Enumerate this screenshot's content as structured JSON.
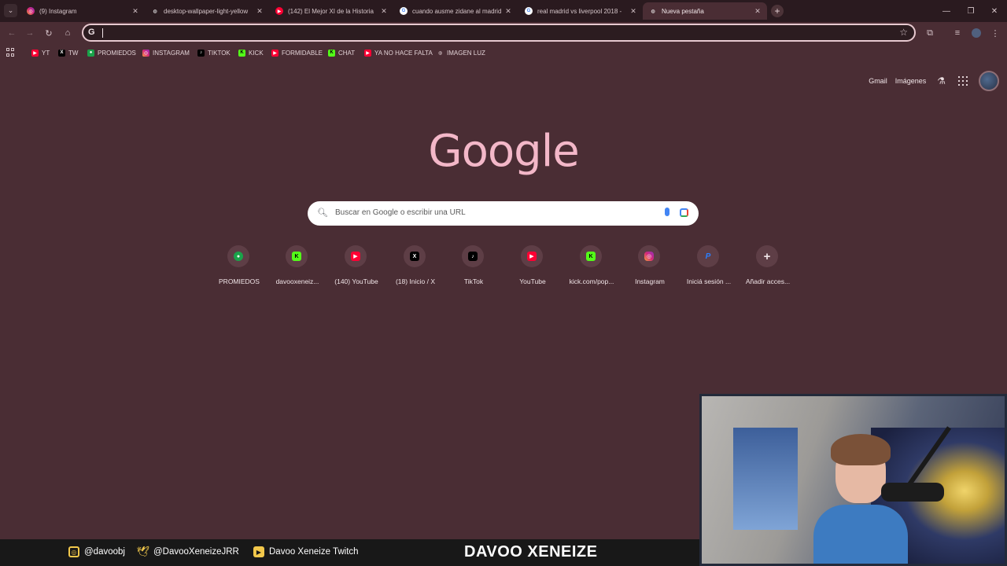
{
  "browser": {
    "tabs": [
      {
        "title": "(9) Instagram",
        "icon": "instagram-icon",
        "active": false
      },
      {
        "title": "desktop-wallpaper-light-yellow",
        "icon": "globe-icon",
        "active": false
      },
      {
        "title": "(142) El Mejor XI de la Historia",
        "icon": "youtube-icon",
        "active": false
      },
      {
        "title": "cuando ausme zidane al madrid",
        "icon": "google-icon",
        "active": false
      },
      {
        "title": "real madrid vs liverpool 2018 -",
        "icon": "google-icon",
        "active": false
      },
      {
        "title": "Nueva pestaña",
        "icon": "chrome-icon",
        "active": true
      }
    ],
    "close_glyph": "✕",
    "new_tab_glyph": "+",
    "omnibox": {
      "value": "",
      "placeholder": ""
    },
    "bookmarks": [
      {
        "label": "YT",
        "icon": "youtube-icon"
      },
      {
        "label": "TW",
        "icon": "x-icon"
      },
      {
        "label": "PROMIEDOS",
        "icon": "promiedos-icon"
      },
      {
        "label": "INSTAGRAM",
        "icon": "instagram-icon"
      },
      {
        "label": "TIKTOK",
        "icon": "tiktok-icon"
      },
      {
        "label": "KICK",
        "icon": "kick-icon"
      },
      {
        "label": "FORMIDABLE",
        "icon": "youtube-icon"
      },
      {
        "label": "CHAT",
        "icon": "kick-icon"
      },
      {
        "label": "YA NO HACE FALTA",
        "icon": "youtube-icon"
      },
      {
        "label": "IMAGEN LUZ",
        "icon": "globe-icon"
      }
    ]
  },
  "google": {
    "logo": "Google",
    "links": {
      "gmail": "Gmail",
      "images": "Imágenes"
    },
    "search_placeholder": "Buscar en Google o escribir una URL",
    "shortcuts": [
      {
        "label": "PROMIEDOS",
        "icon": "promiedos-icon"
      },
      {
        "label": "davooxeneiz...",
        "icon": "kick-icon"
      },
      {
        "label": "(140) YouTube",
        "icon": "youtube-icon"
      },
      {
        "label": "(18) Inicio / X",
        "icon": "x-icon"
      },
      {
        "label": "TikTok",
        "icon": "tiktok-icon"
      },
      {
        "label": "YouTube",
        "icon": "youtube-icon"
      },
      {
        "label": "kick.com/pop...",
        "icon": "kick-icon"
      },
      {
        "label": "Instagram",
        "icon": "instagram-icon"
      },
      {
        "label": "Iniciá sesión ...",
        "icon": "paypal-icon"
      },
      {
        "label": "Añadir acces...",
        "icon": "plus-icon"
      }
    ]
  },
  "overlay": {
    "instagram": "@davoobj",
    "twitter": "@DavooXeneizeJRR",
    "twitch": "Davoo Xeneize Twitch",
    "brand": "DAVOO XENEIZE"
  },
  "colors": {
    "background": "#4a2d34",
    "tabstrip": "#2a1a1f",
    "logo": "#f3b7c8",
    "omnibox_border": "#e8c9d0"
  }
}
